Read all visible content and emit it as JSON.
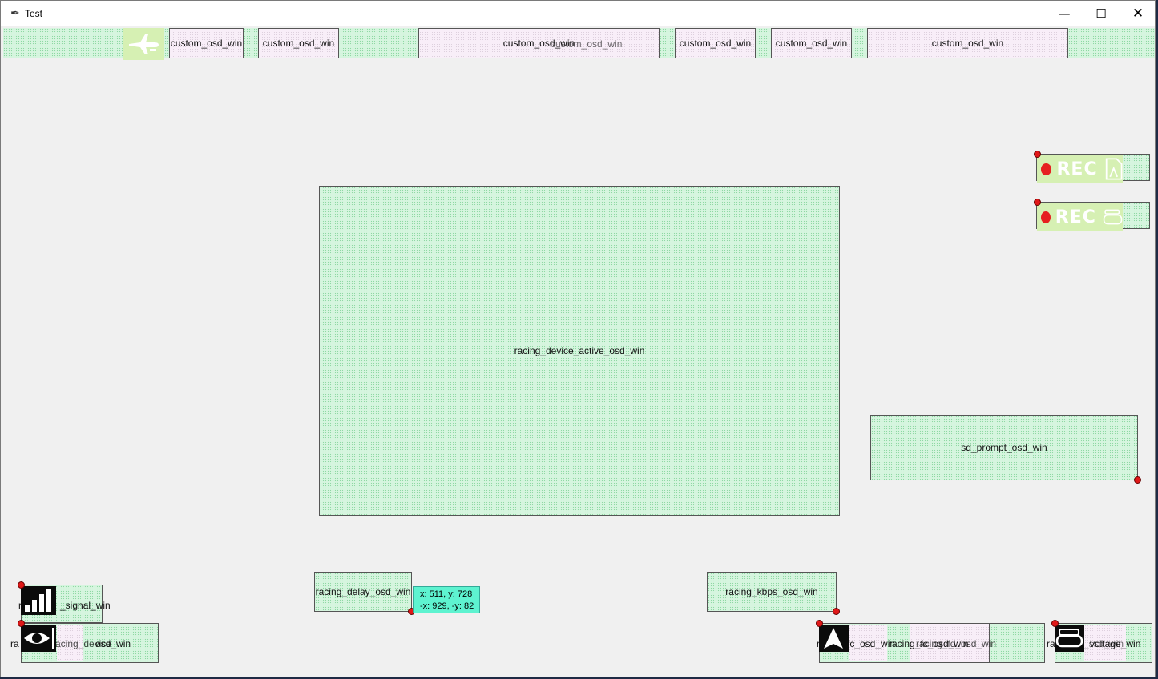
{
  "window": {
    "title": "Test",
    "app_icon": "feather-icon",
    "controls": {
      "minimize": "—",
      "maximize": "☐",
      "close": "✕"
    }
  },
  "top_row": {
    "labels": [
      "custom_osd_win",
      "custom_osd_win",
      "custom_osd_win",
      "custom_osd_win",
      "custom_osd_win",
      "custom_osd_win",
      "custom_osd_win"
    ],
    "overlap_label": "custom_osd_win",
    "plane_icon": "airplane-icon"
  },
  "center": {
    "label": "racing_device_active_osd_win"
  },
  "sd_prompt": {
    "label": "sd_prompt_osd_win"
  },
  "rec_items": [
    {
      "text": "REC",
      "icon": "sd-card-rec-icon"
    },
    {
      "text": "REC",
      "icon": "goggles-rec-icon"
    }
  ],
  "bottom": {
    "signal": {
      "text": "r",
      "label": "_signal_win",
      "icon": "signal-bars-icon"
    },
    "eye": {
      "prefix": "ra",
      "overlap_label": "racing_device",
      "label": "osd_win",
      "icon": "eye-icon"
    },
    "delay": {
      "label": "racing_delay_osd_win"
    },
    "kbps": {
      "label": "racing_kbps_osd_win"
    },
    "nav": {
      "prefix": "r",
      "label_a": "fc_osd_win",
      "label_b": "racing_fc_osd_win",
      "label_c": "racing_fd_osd_win",
      "icon": "navigation-arrow-icon"
    },
    "voltage": {
      "prefix": "ra",
      "label_a": "voltage_win",
      "label_b": "_ssd_win",
      "icon": "vr-goggles-icon"
    }
  },
  "tooltip": {
    "line1": "x: 511, y: 728",
    "line2": "-x: 929, -y: 82"
  }
}
